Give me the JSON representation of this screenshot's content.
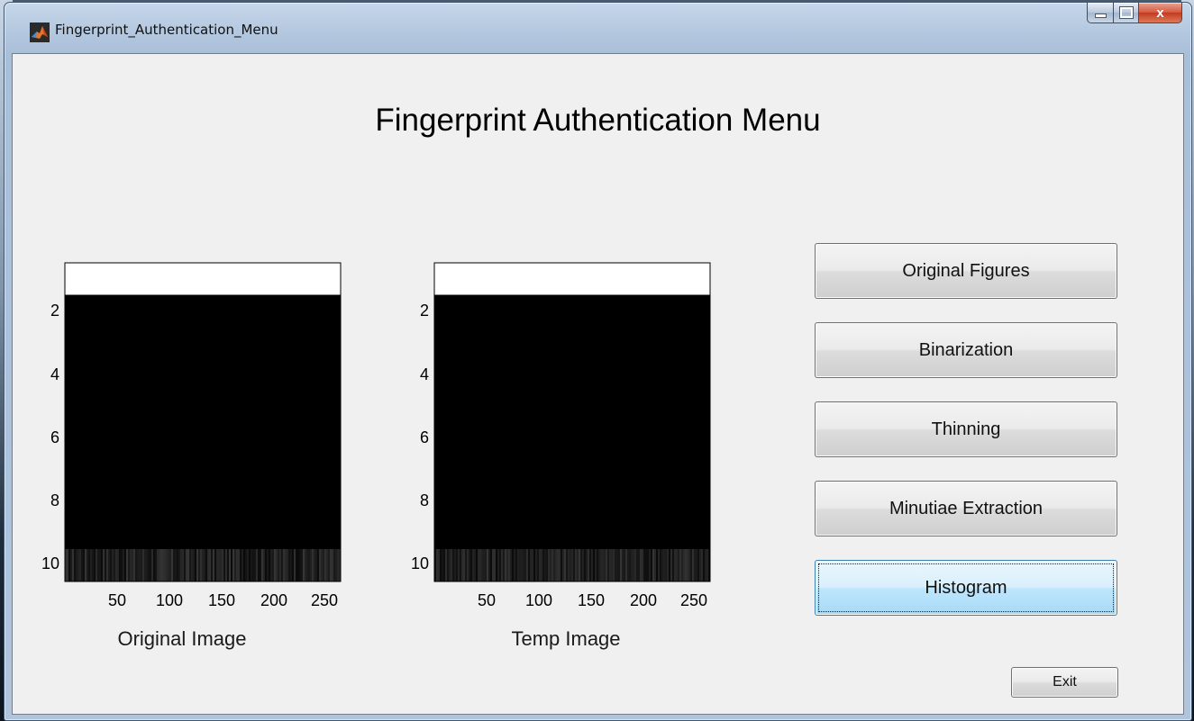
{
  "window": {
    "title": "Fingerprint_Authentication_Menu",
    "caption_buttons": {
      "minimize": "",
      "maximize": "",
      "close": "x"
    }
  },
  "heading": "Fingerprint Authentication Menu",
  "axes": [
    {
      "label": "Original Image",
      "y_ticks": [
        "2",
        "4",
        "6",
        "8",
        "10"
      ],
      "x_ticks": [
        "50",
        "100",
        "150",
        "200",
        "250"
      ]
    },
    {
      "label": "Temp Image",
      "y_ticks": [
        "2",
        "4",
        "6",
        "8",
        "10"
      ],
      "x_ticks": [
        "50",
        "100",
        "150",
        "200",
        "250"
      ]
    }
  ],
  "buttons": [
    {
      "label": "Original Figures"
    },
    {
      "label": "Binarization"
    },
    {
      "label": "Thinning"
    },
    {
      "label": "Minutiae Extraction"
    },
    {
      "label": "Histogram",
      "focused": true
    }
  ],
  "exit_label": "Exit",
  "colors": {
    "client_bg": "#f0f0f0",
    "image_fill": "#000000",
    "focus_blue": "#bee6fd"
  }
}
